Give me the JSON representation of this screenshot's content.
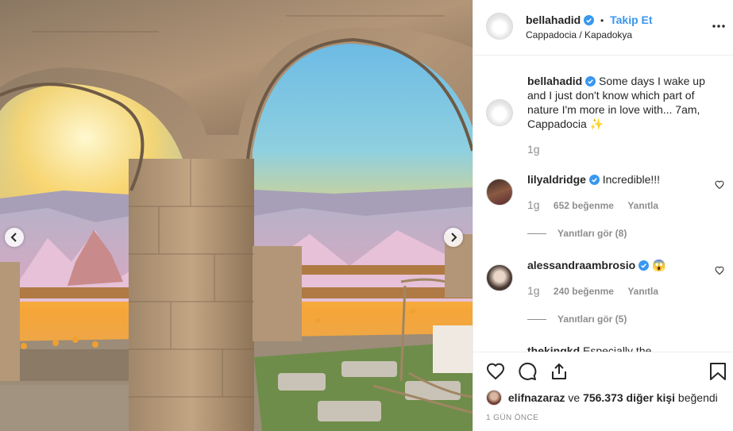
{
  "post": {
    "username": "bellahadid",
    "separator": "•",
    "follow_label": "Takip Et",
    "location": "Cappadocia / Kapadokya",
    "caption": "Some days I wake up and I just don't know which part of nature I'm more in love with... 7am, Cappadocia ✨",
    "caption_time": "1g"
  },
  "comments": [
    {
      "username": "lilyaldridge",
      "text": "Incredible!!!",
      "time": "1g",
      "likes": "652 beğenme",
      "reply_label": "Yanıtla",
      "view_replies": "Yanıtları gör (8)"
    },
    {
      "username": "alessandraambrosio",
      "text": "😱",
      "time": "1g",
      "likes": "240 beğenme",
      "reply_label": "Yanıtla",
      "view_replies": "Yanıtları gör (5)"
    },
    {
      "username": "thekingkd",
      "text": "Especially the"
    }
  ],
  "footer": {
    "liked_user": "elifnazaraz",
    "liked_connector": "ve",
    "liked_count": "756.373 diğer kişi",
    "liked_suffix": "beğendi",
    "date": "1 GÜN ÖNCE"
  },
  "icons": {
    "verified": "verified-badge-icon",
    "more": "more-options-icon",
    "heart": "heart-icon",
    "comment": "comment-icon",
    "share": "share-icon",
    "save": "bookmark-icon",
    "prev": "chevron-left-icon",
    "next": "chevron-right-icon"
  },
  "colors": {
    "link_blue": "#3897f0",
    "verified_blue": "#3897f0",
    "text": "#262626",
    "muted": "#8e8e8e",
    "divider": "#efefef"
  }
}
